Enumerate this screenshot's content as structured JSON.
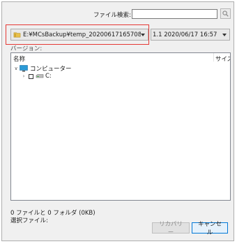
{
  "search": {
    "label": "ファイル検索:",
    "value": "",
    "button_icon": "search-icon"
  },
  "path_select": {
    "value": "E:¥MCsBackup¥temp_20200617165708",
    "icon": "folder-icon"
  },
  "version_select": {
    "value": "1.1   2020/06/17 16:57"
  },
  "version_label": "バージョン:",
  "file_list": {
    "columns": [
      "名称",
      "サイズ"
    ],
    "tree": [
      {
        "label": "コンピューター",
        "icon": "computer-icon",
        "expanded": true
      },
      {
        "label": "C:",
        "icon": "drive-icon",
        "expanded": false,
        "checked": false
      }
    ]
  },
  "status": {
    "summary": "0 ファイルと 0 フォルダ (0KB)",
    "selected_label": "選択ファイル:"
  },
  "buttons": {
    "restore": "リカバリー",
    "cancel": "キャンセル"
  },
  "colors": {
    "highlight": "#e53935",
    "accent": "#0078d7",
    "computer_icon": "#2b9ad6",
    "folder_icon": "#e8c04a"
  }
}
